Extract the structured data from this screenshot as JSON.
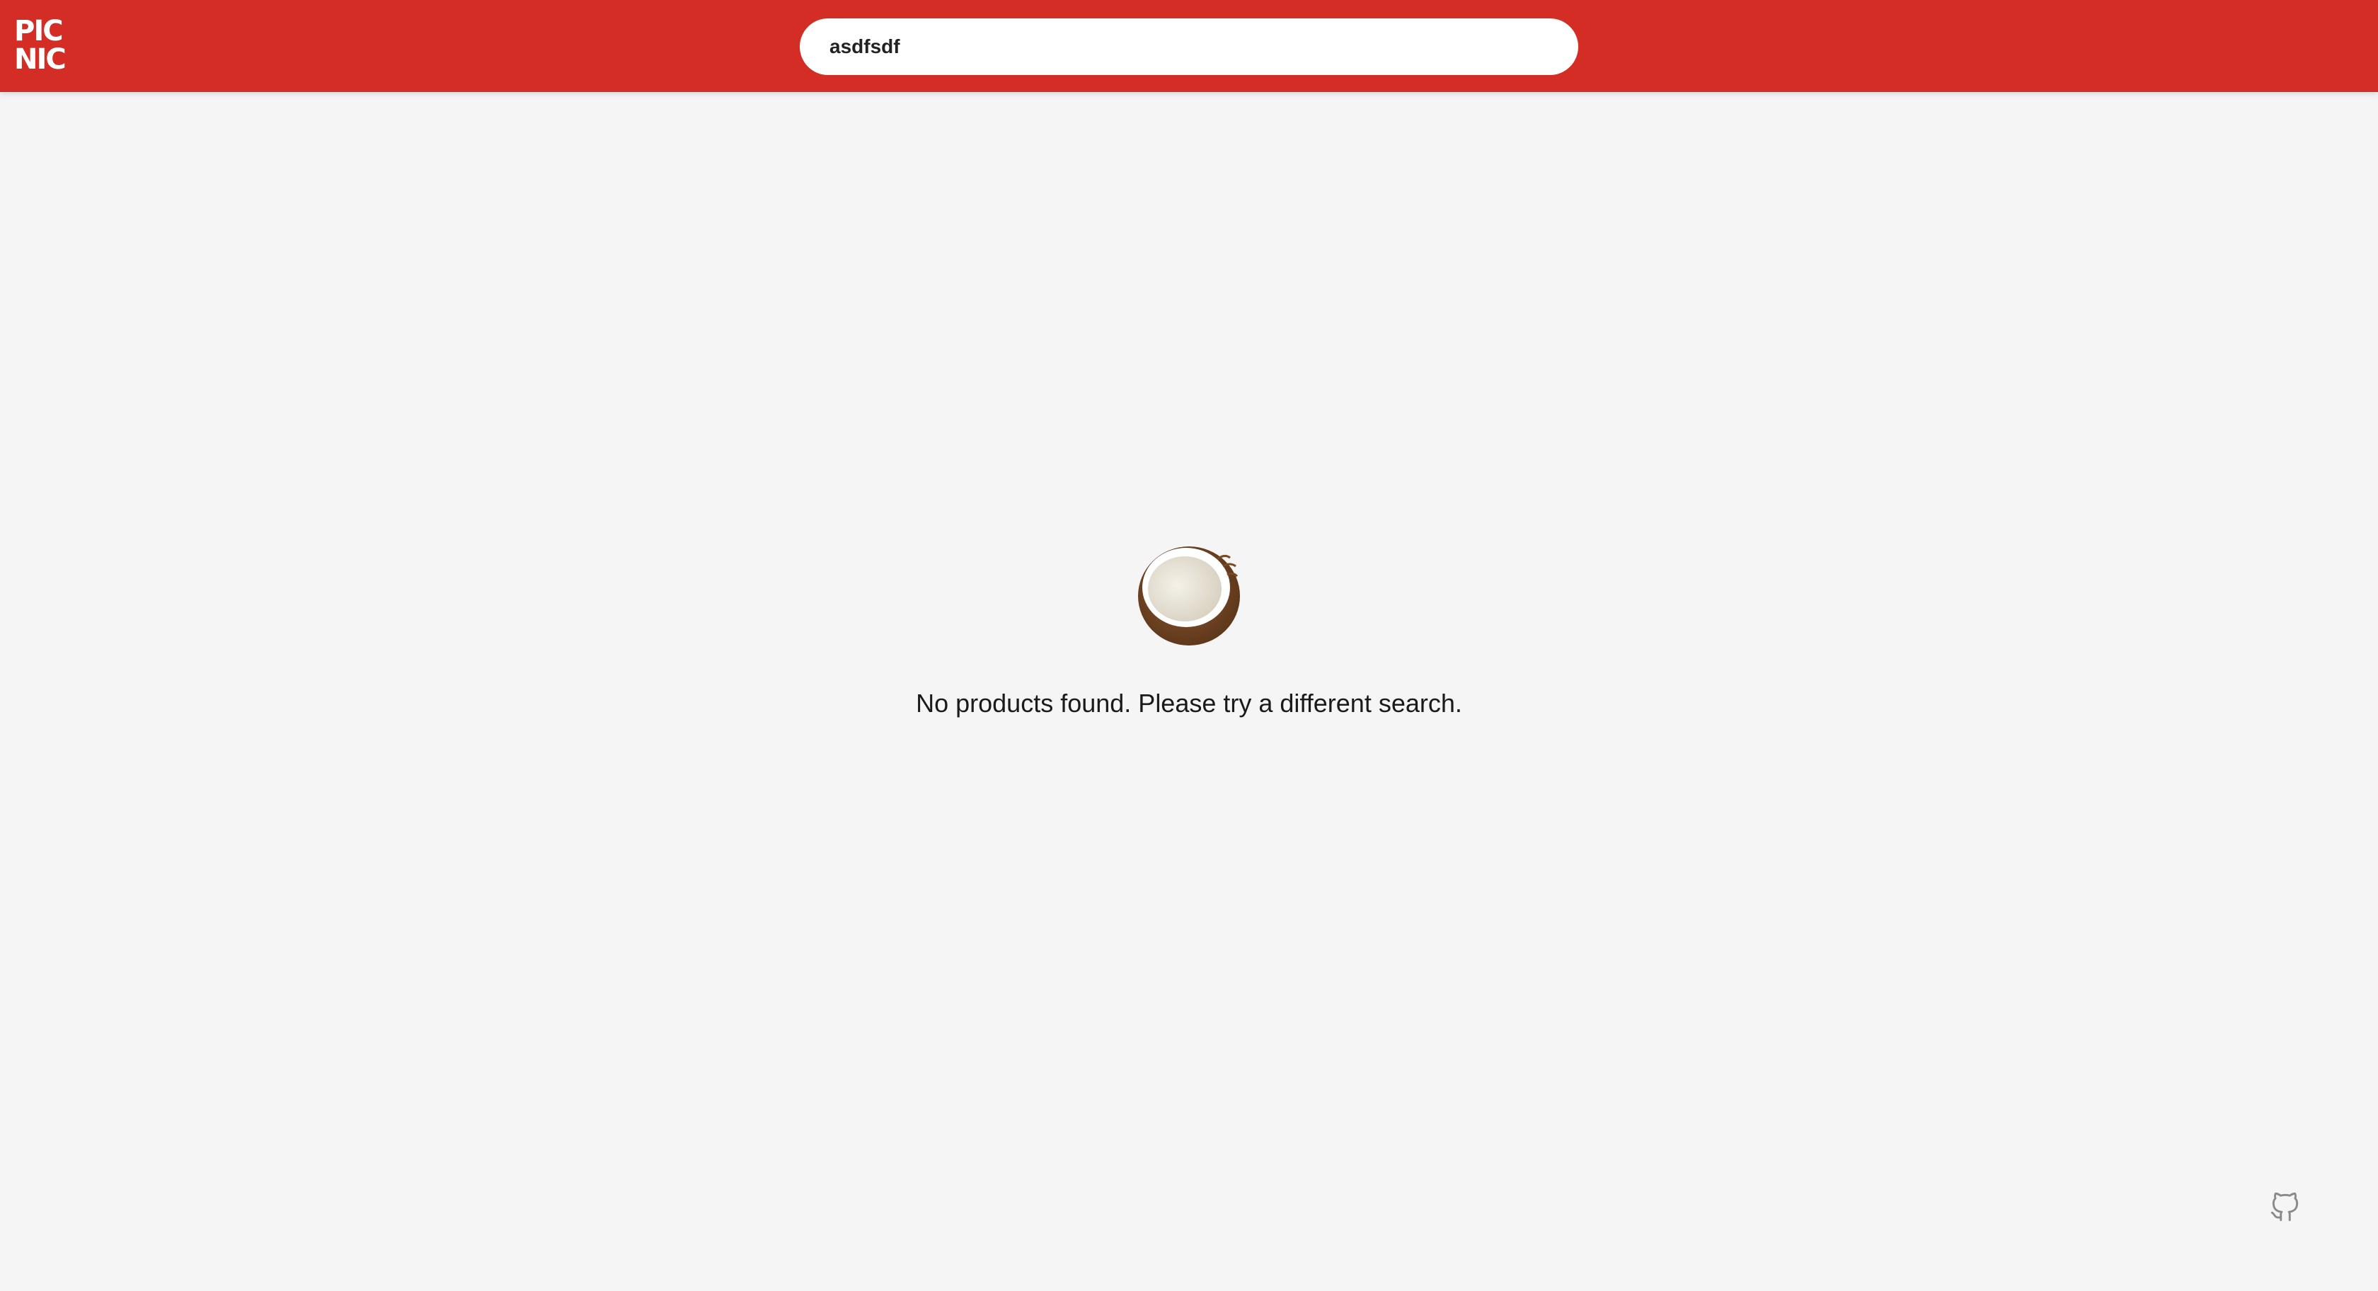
{
  "header": {
    "logo_line1": "PIC",
    "logo_line2": "NIC",
    "brand_color": "#d42d25"
  },
  "search": {
    "value": "asdfsdf"
  },
  "empty_state": {
    "icon": "coconut-icon",
    "message": "No products found. Please try a different search."
  },
  "footer": {
    "icon": "github-icon"
  }
}
